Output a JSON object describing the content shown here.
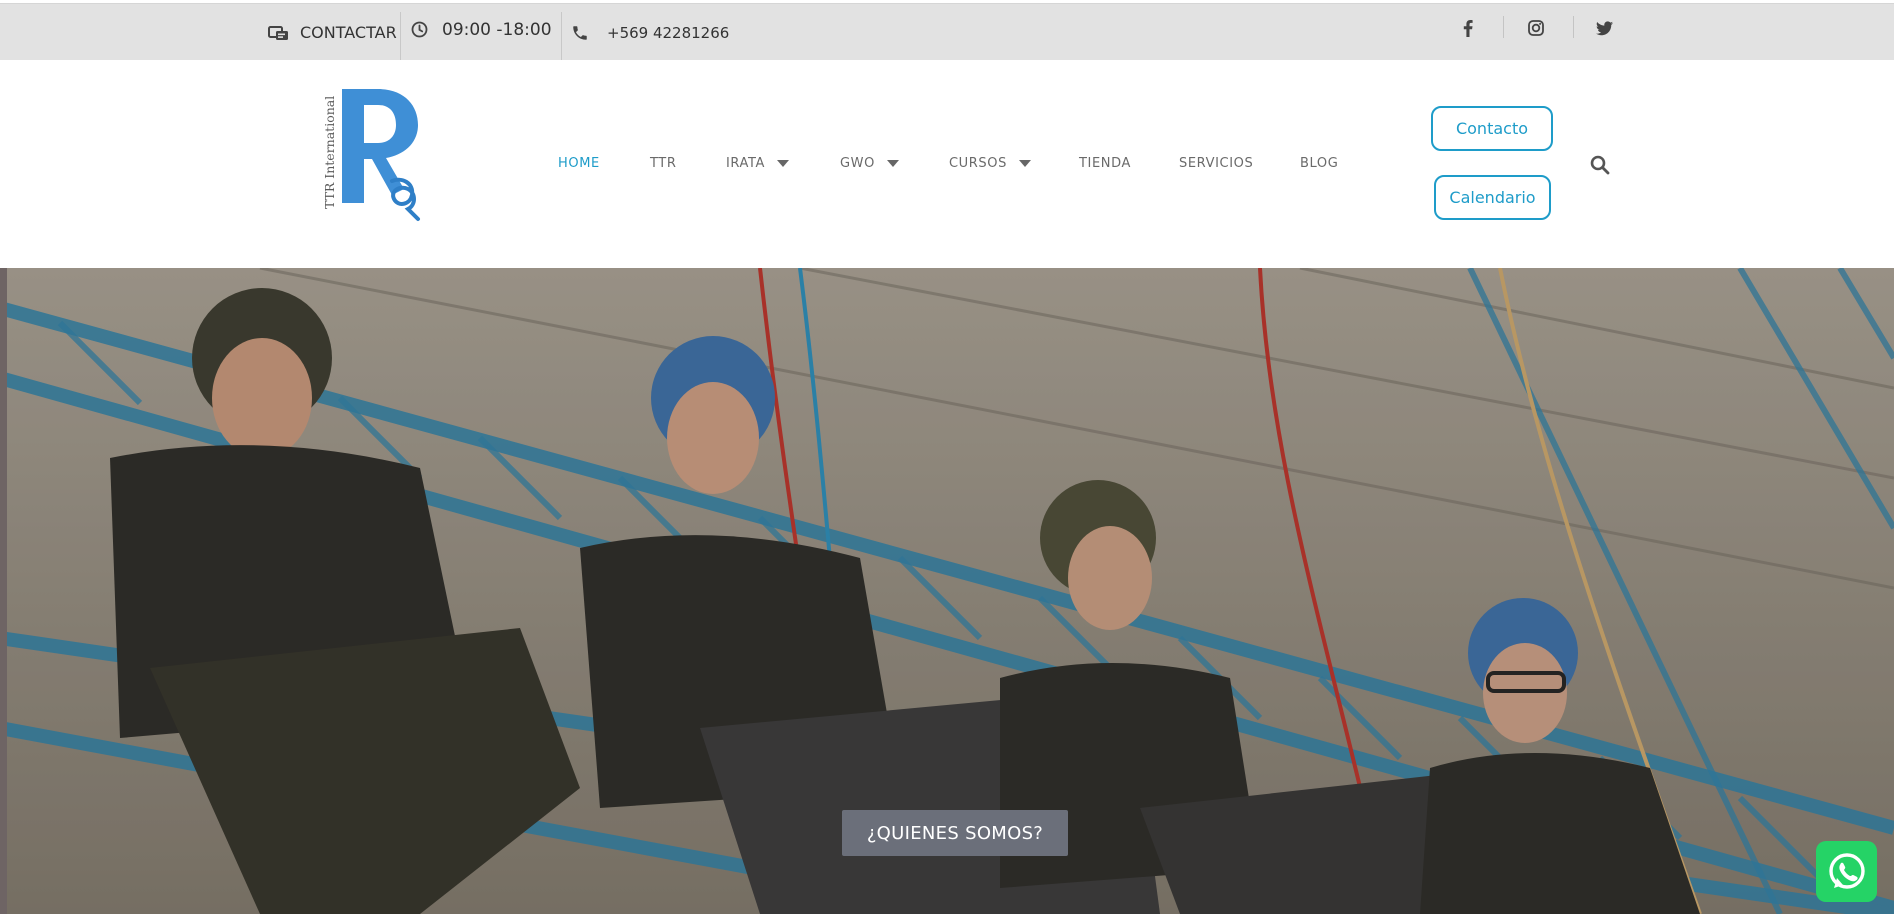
{
  "topbar": {
    "contact_label": "CONTACTAR",
    "hours": "09:00 -18:00",
    "phone": "+569 42281266",
    "social": [
      "facebook-icon",
      "instagram-icon",
      "twitter-icon"
    ]
  },
  "brand": {
    "logo_text": "TTR International",
    "accent_color": "#1e9cc9"
  },
  "nav": {
    "items": [
      {
        "label": "HOME",
        "active": true
      },
      {
        "label": "TTR"
      },
      {
        "label": "IRATA",
        "dropdown": true
      },
      {
        "label": "GWO",
        "dropdown": true
      },
      {
        "label": "CURSOS",
        "dropdown": true
      },
      {
        "label": "TIENDA"
      },
      {
        "label": "SERVICIOS"
      },
      {
        "label": "BLOG"
      }
    ]
  },
  "header_buttons": {
    "contacto": "Contacto",
    "calendario": "Calendario"
  },
  "hero": {
    "button_label": "¿QUIENES SOMOS?"
  },
  "widgets": {
    "whatsapp_icon": "whatsapp-icon"
  }
}
